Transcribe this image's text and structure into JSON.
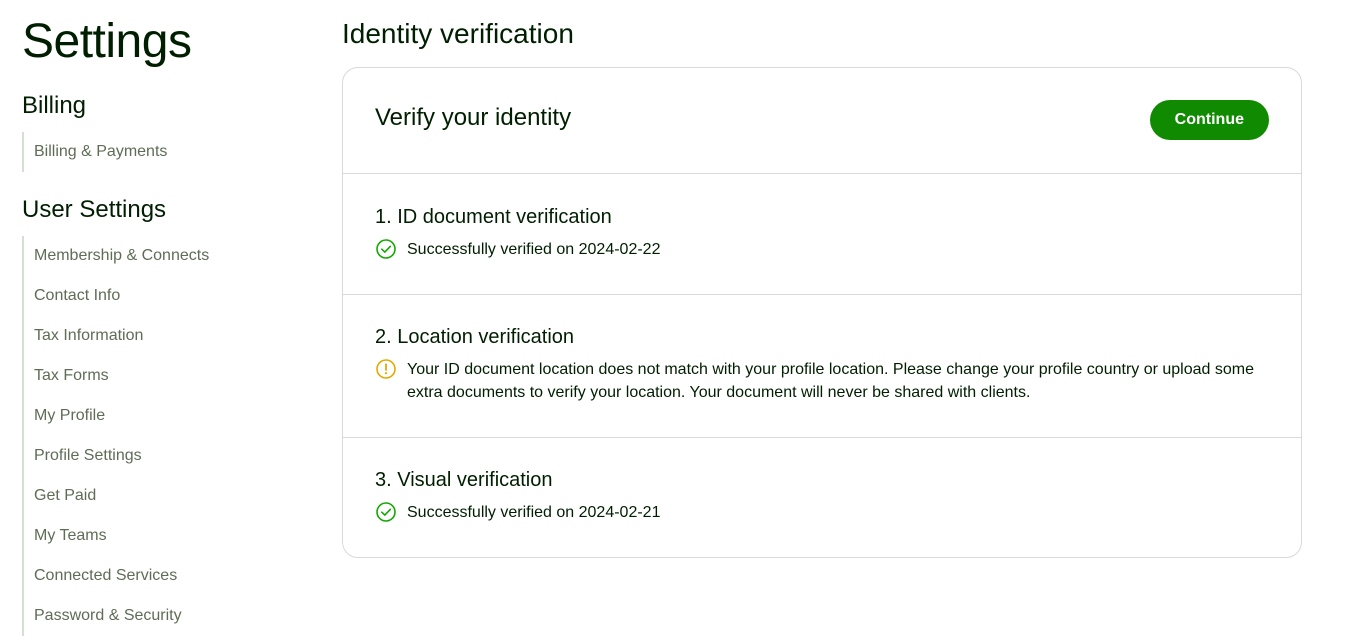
{
  "sidebar": {
    "title": "Settings",
    "billing_heading": "Billing",
    "billing_items": [
      {
        "label": "Billing & Payments"
      }
    ],
    "user_settings_heading": "User Settings",
    "user_items": [
      {
        "label": "Membership & Connects"
      },
      {
        "label": "Contact Info"
      },
      {
        "label": "Tax Information"
      },
      {
        "label": "Tax Forms"
      },
      {
        "label": "My Profile"
      },
      {
        "label": "Profile Settings"
      },
      {
        "label": "Get Paid"
      },
      {
        "label": "My Teams"
      },
      {
        "label": "Connected Services"
      },
      {
        "label": "Password & Security"
      }
    ]
  },
  "main": {
    "page_title": "Identity verification",
    "card": {
      "title": "Verify your identity",
      "continue_label": "Continue",
      "steps": [
        {
          "title": "1. ID document verification",
          "status": "success",
          "icon": "check-circle-icon",
          "message": "Successfully verified on 2024-02-22"
        },
        {
          "title": "2. Location verification",
          "status": "warning",
          "icon": "warning-circle-icon",
          "message": "Your ID document location does not match with your profile location. Please change your profile country or upload some extra documents to verify your location. Your document will never be shared with clients."
        },
        {
          "title": "3. Visual verification",
          "status": "success",
          "icon": "check-circle-icon",
          "message": "Successfully verified on 2024-02-21"
        }
      ]
    }
  },
  "colors": {
    "accent": "#108a00",
    "success": "#14a800",
    "warning": "#e5a800",
    "text": "#001e00",
    "muted": "#5e6d55",
    "border": "#d9d9d9"
  }
}
